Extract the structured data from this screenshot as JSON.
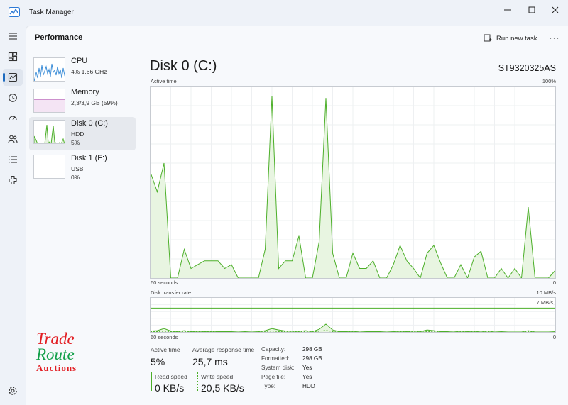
{
  "window": {
    "title": "Task Manager"
  },
  "header": {
    "page_title": "Performance",
    "run_new_task": "Run new task",
    "more": "···"
  },
  "nav": [
    {
      "icon": "hamburger-menu-icon"
    },
    {
      "icon": "processes-icon"
    },
    {
      "icon": "performance-icon",
      "active": true
    },
    {
      "icon": "app-history-icon"
    },
    {
      "icon": "startup-apps-icon"
    },
    {
      "icon": "users-icon"
    },
    {
      "icon": "details-icon"
    },
    {
      "icon": "services-icon"
    },
    {
      "icon": "settings-icon"
    }
  ],
  "devices": [
    {
      "name": "CPU",
      "line1": "4%  1,66 GHz",
      "line2": "",
      "color": "#3f8fd8"
    },
    {
      "name": "Memory",
      "line1": "2,3/3,9 GB (59%)",
      "line2": "",
      "color": "#a63ba6"
    },
    {
      "name": "Disk 0 (C:)",
      "line1": "HDD",
      "line2": "5%",
      "color": "#4caf29",
      "selected": true
    },
    {
      "name": "Disk 1 (F:)",
      "line1": "USB",
      "line2": "0%",
      "color": "#4caf29"
    }
  ],
  "logo": {
    "line1": "Trade",
    "line2": "Route",
    "line3": "Auctions"
  },
  "detail": {
    "title": "Disk 0 (C:)",
    "model": "ST9320325AS",
    "active_time_label": "Active time",
    "active_time_max": "100%",
    "time_axis_left": "60 seconds",
    "time_axis_right": "0",
    "transfer_label": "Disk transfer rate",
    "transfer_max": "10 MB/s",
    "transfer_line": "7 MB/s",
    "transfer_axis_left": "60 seconds",
    "transfer_axis_right": "0"
  },
  "stats": {
    "active_time_label": "Active time",
    "active_time_value": "5%",
    "response_label": "Average response time",
    "response_value": "25,7 ms",
    "read_label": "Read speed",
    "read_value": "0 KB/s",
    "write_label": "Write speed",
    "write_value": "20,5 KB/s"
  },
  "properties": [
    {
      "key": "Capacity:",
      "value": "298 GB"
    },
    {
      "key": "Formatted:",
      "value": "298 GB"
    },
    {
      "key": "System disk:",
      "value": "Yes"
    },
    {
      "key": "Page file:",
      "value": "Yes"
    },
    {
      "key": "Type:",
      "value": "HDD"
    }
  ],
  "chart_data": [
    {
      "type": "area",
      "title": "Active time",
      "x_range_seconds": [
        60,
        0
      ],
      "ylim": [
        0,
        100
      ],
      "y_unit": "%",
      "color": "#4caf29",
      "values": [
        55,
        45,
        60,
        0,
        0,
        15,
        5,
        7,
        9,
        9,
        9,
        5,
        7,
        0,
        0,
        0,
        0,
        15,
        95,
        5,
        9,
        9,
        22,
        0,
        0,
        19,
        94,
        13,
        0,
        0,
        13,
        5,
        5,
        9,
        0,
        0,
        7,
        17,
        9,
        5,
        0,
        13,
        17,
        8,
        0,
        0,
        7,
        0,
        11,
        14,
        0,
        0,
        5,
        0,
        5,
        0,
        37,
        0,
        0,
        0,
        4
      ]
    },
    {
      "type": "area",
      "title": "Disk transfer rate",
      "x_range_seconds": [
        60,
        0
      ],
      "ylim": [
        0,
        10
      ],
      "y_unit": "MB/s",
      "reference_line": 7,
      "series": [
        {
          "name": "Read speed",
          "values": [
            0.3,
            0.4,
            1.0,
            0.3,
            0.1,
            0.4,
            0.1,
            0.2,
            0.1,
            0.2,
            0.1,
            0.1,
            0.1,
            0.0,
            0.1,
            0.0,
            0.1,
            0.4,
            1.0,
            0.6,
            0.3,
            0.2,
            0.2,
            0.4,
            0.1,
            0.8,
            2.3,
            0.6,
            0.1,
            0.1,
            0.2,
            0.0,
            0.1,
            0.1,
            0.1,
            0.0,
            0.1,
            0.2,
            0.1,
            0.3,
            0.1,
            0.6,
            0.4,
            0.1,
            0.1,
            0.0,
            0.3,
            0.1,
            0.2,
            0.0,
            0.3,
            0.0,
            0.1,
            0.0,
            0.0,
            0.0,
            0.4,
            0.0,
            0.0,
            0.0,
            0.1
          ]
        },
        {
          "name": "Write speed",
          "values": [
            0.1,
            0.1,
            0.2,
            0.1,
            0.0,
            0.1,
            0.0,
            0.1,
            0.0,
            0.1,
            0.0,
            0.0,
            0.0,
            0.0,
            0.0,
            0.0,
            0.0,
            0.1,
            0.3,
            0.1,
            0.1,
            0.0,
            0.1,
            0.1,
            0.0,
            0.2,
            0.5,
            0.1,
            0.0,
            0.0,
            0.1,
            0.0,
            0.0,
            0.0,
            0.0,
            0.0,
            0.0,
            0.1,
            0.0,
            0.1,
            0.0,
            0.1,
            0.1,
            0.0,
            0.0,
            0.0,
            0.1,
            0.0,
            0.0,
            0.0,
            0.1,
            0.0,
            0.0,
            0.0,
            0.0,
            0.0,
            0.1,
            0.0,
            0.0,
            0.0,
            0.0
          ]
        }
      ]
    }
  ]
}
